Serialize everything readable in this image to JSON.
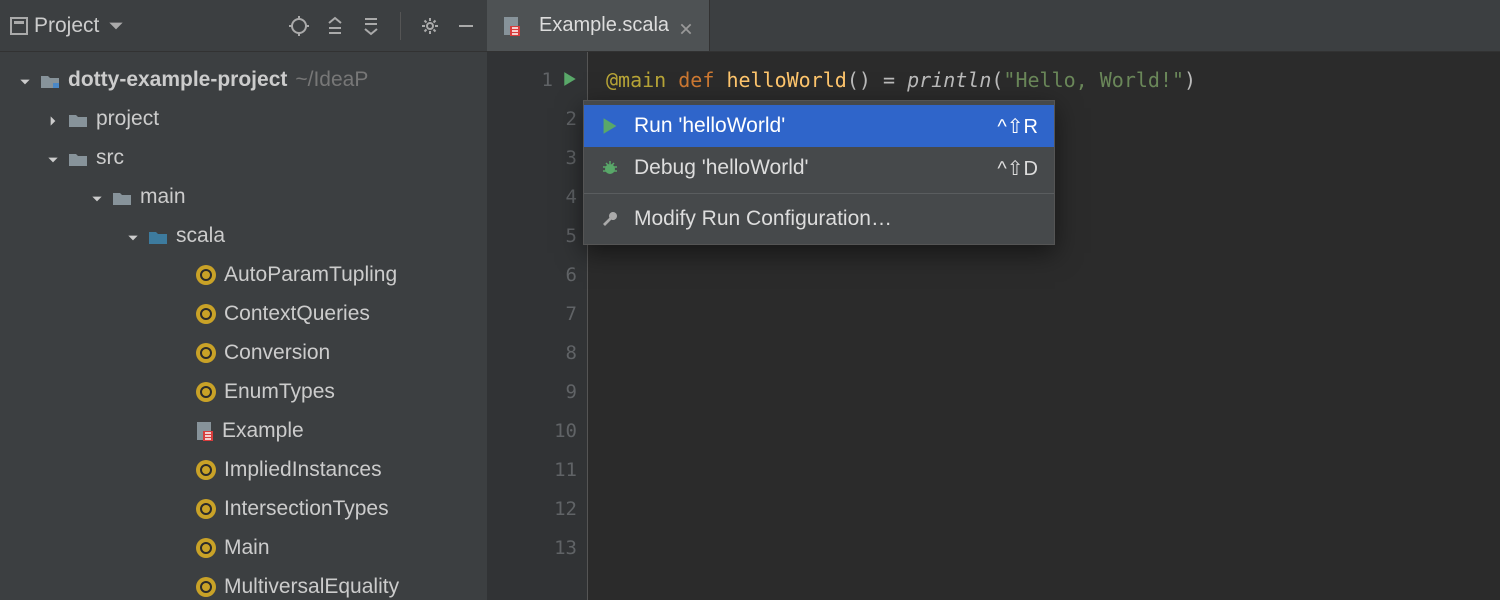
{
  "toolbar": {
    "project_label": "Project"
  },
  "tree": {
    "root": {
      "label": "dotty-example-project",
      "hint": "~/IdeaP"
    },
    "project_folder": "project",
    "src": "src",
    "main": "main",
    "scala": "scala",
    "files": [
      "AutoParamTupling",
      "ContextQueries",
      "Conversion",
      "EnumTypes",
      "Example",
      "ImpliedInstances",
      "IntersectionTypes",
      "Main",
      "MultiversalEquality"
    ]
  },
  "tab": {
    "filename": "Example.scala"
  },
  "code": {
    "annotation": "@main",
    "def": "def",
    "fn": "helloWorld",
    "parens": "()",
    "eq": " = ",
    "call": "println",
    "open": "(",
    "str": "\"Hello, World!\"",
    "close": ")"
  },
  "line_numbers": [
    "1",
    "2",
    "3",
    "4",
    "5",
    "6",
    "7",
    "8",
    "9",
    "10",
    "11",
    "12",
    "13"
  ],
  "menu": {
    "run": {
      "label": "Run 'helloWorld'",
      "shortcut": "^⇧R"
    },
    "debug": {
      "label": "Debug 'helloWorld'",
      "shortcut": "^⇧D"
    },
    "modify": {
      "label": "Modify Run Configuration…"
    }
  }
}
